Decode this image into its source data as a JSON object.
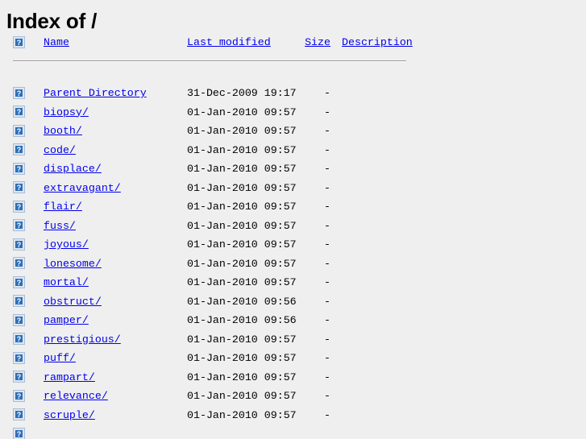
{
  "page": {
    "title": "Index of /",
    "background_color": "#efefef",
    "link_color": "#0000ee",
    "text_color": "#000000"
  },
  "table": {
    "icon_name": "broken-image-icon",
    "headers": {
      "name": "Name",
      "last_modified": "Last modified",
      "size": "Size",
      "description": "Description"
    },
    "rows": [
      {
        "name": "Parent Directory",
        "last_modified": "31-Dec-2009 19:17",
        "size": "-",
        "description": ""
      },
      {
        "name": "biopsy/",
        "last_modified": "01-Jan-2010 09:57",
        "size": "-",
        "description": ""
      },
      {
        "name": "booth/",
        "last_modified": "01-Jan-2010 09:57",
        "size": "-",
        "description": ""
      },
      {
        "name": "code/",
        "last_modified": "01-Jan-2010 09:57",
        "size": "-",
        "description": ""
      },
      {
        "name": "displace/",
        "last_modified": "01-Jan-2010 09:57",
        "size": "-",
        "description": ""
      },
      {
        "name": "extravagant/",
        "last_modified": "01-Jan-2010 09:57",
        "size": "-",
        "description": ""
      },
      {
        "name": "flair/",
        "last_modified": "01-Jan-2010 09:57",
        "size": "-",
        "description": ""
      },
      {
        "name": "fuss/",
        "last_modified": "01-Jan-2010 09:57",
        "size": "-",
        "description": ""
      },
      {
        "name": "joyous/",
        "last_modified": "01-Jan-2010 09:57",
        "size": "-",
        "description": ""
      },
      {
        "name": "lonesome/",
        "last_modified": "01-Jan-2010 09:57",
        "size": "-",
        "description": ""
      },
      {
        "name": "mortal/",
        "last_modified": "01-Jan-2010 09:57",
        "size": "-",
        "description": ""
      },
      {
        "name": "obstruct/",
        "last_modified": "01-Jan-2010 09:56",
        "size": "-",
        "description": ""
      },
      {
        "name": "pamper/",
        "last_modified": "01-Jan-2010 09:56",
        "size": "-",
        "description": ""
      },
      {
        "name": "prestigious/",
        "last_modified": "01-Jan-2010 09:57",
        "size": "-",
        "description": ""
      },
      {
        "name": "puff/",
        "last_modified": "01-Jan-2010 09:57",
        "size": "-",
        "description": ""
      },
      {
        "name": "rampart/",
        "last_modified": "01-Jan-2010 09:57",
        "size": "-",
        "description": ""
      },
      {
        "name": "relevance/",
        "last_modified": "01-Jan-2010 09:57",
        "size": "-",
        "description": ""
      },
      {
        "name": "scruple/",
        "last_modified": "01-Jan-2010 09:57",
        "size": "-",
        "description": ""
      }
    ]
  }
}
